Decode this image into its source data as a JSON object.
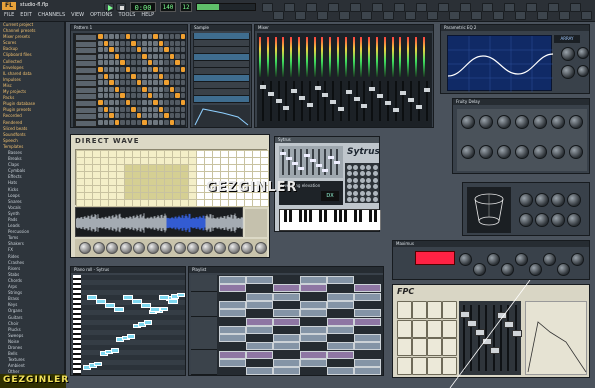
{
  "topbar": {
    "logo": "FL",
    "song_title": "studio-fl.flp",
    "menu": [
      "FILE",
      "EDIT",
      "CHANNELS",
      "VIEW",
      "OPTIONS",
      "TOOLS",
      "HELP"
    ],
    "time_display": "0:00",
    "tempo_display": "140",
    "pattern_display": "12"
  },
  "browser": {
    "items": [
      {
        "label": "Current project",
        "folder": true
      },
      {
        "label": "Channel presets",
        "folder": true
      },
      {
        "label": "Mixer presets",
        "folder": true
      },
      {
        "label": "Scores",
        "folder": true
      },
      {
        "label": "Backup",
        "folder": true
      },
      {
        "label": "Clipboard files",
        "folder": true
      },
      {
        "label": "Collected",
        "folder": true
      },
      {
        "label": "Envelopes",
        "folder": true
      },
      {
        "label": "IL shared data",
        "folder": true
      },
      {
        "label": "Impulses",
        "folder": true
      },
      {
        "label": "Misc",
        "folder": true
      },
      {
        "label": "My projects",
        "folder": true
      },
      {
        "label": "Packs",
        "folder": true
      },
      {
        "label": "Plugin database",
        "folder": true
      },
      {
        "label": "Plugin presets",
        "folder": true
      },
      {
        "label": "Recorded",
        "folder": true
      },
      {
        "label": "Rendered",
        "folder": true
      },
      {
        "label": "Sliced beats",
        "folder": true
      },
      {
        "label": "Soundfonts",
        "folder": true
      },
      {
        "label": "Speech",
        "folder": true
      },
      {
        "label": "Templates",
        "folder": true
      },
      {
        "label": "Basses",
        "folder": false
      },
      {
        "label": "Breaks",
        "folder": false
      },
      {
        "label": "Claps",
        "folder": false
      },
      {
        "label": "Cymbals",
        "folder": false
      },
      {
        "label": "Effects",
        "folder": false
      },
      {
        "label": "Hats",
        "folder": false
      },
      {
        "label": "Kicks",
        "folder": false
      },
      {
        "label": "Loops",
        "folder": false
      },
      {
        "label": "Snares",
        "folder": false
      },
      {
        "label": "Vocals",
        "folder": false
      },
      {
        "label": "Synth",
        "folder": false
      },
      {
        "label": "Pads",
        "folder": false
      },
      {
        "label": "Leads",
        "folder": false
      },
      {
        "label": "Percussion",
        "folder": false
      },
      {
        "label": "Toms",
        "folder": false
      },
      {
        "label": "Shakers",
        "folder": false
      },
      {
        "label": "FX",
        "folder": false
      },
      {
        "label": "Rides",
        "folder": false
      },
      {
        "label": "Crashes",
        "folder": false
      },
      {
        "label": "Risers",
        "folder": false
      },
      {
        "label": "Stabs",
        "folder": false
      },
      {
        "label": "Chords",
        "folder": false
      },
      {
        "label": "Arps",
        "folder": false
      },
      {
        "label": "Strings",
        "folder": false
      },
      {
        "label": "Brass",
        "folder": false
      },
      {
        "label": "Keys",
        "folder": false
      },
      {
        "label": "Organs",
        "folder": false
      },
      {
        "label": "Guitars",
        "folder": false
      },
      {
        "label": "Choir",
        "folder": false
      },
      {
        "label": "Plucks",
        "folder": false
      },
      {
        "label": "Sweeps",
        "folder": false
      },
      {
        "label": "Noise",
        "folder": false
      },
      {
        "label": "Drones",
        "folder": false
      },
      {
        "label": "Bells",
        "folder": false
      },
      {
        "label": "Textures",
        "folder": false
      },
      {
        "label": "Ambient",
        "folder": false
      },
      {
        "label": "Other",
        "folder": false
      }
    ]
  },
  "windows": {
    "step_sequencer": {
      "title": "Pattern 1"
    },
    "playlist_small": {
      "title": "Sample"
    },
    "mixer": {
      "title": "Mixer"
    },
    "eq": {
      "title": "Parametric EQ 2",
      "badge": "ARRAY"
    },
    "delay": {
      "title": "Fruity Delay"
    },
    "directwave": {
      "title": "DIRECTWAVE",
      "logo": "DIRECT WAVE"
    },
    "sytrus": {
      "title": "Sytrus",
      "logo": "Sytrus",
      "preset": "Sweeping elevation",
      "value": "DX"
    },
    "box3d": {
      "title": "Fruity Spectroman"
    },
    "compressor": {
      "title": "Maximus"
    },
    "piano_roll": {
      "title": "Piano roll - Sytrus"
    },
    "playlist": {
      "title": "Playlist"
    },
    "fpc": {
      "title": "FPC",
      "logo": "FPC"
    },
    "synth_panel": {
      "title": "Slicex"
    }
  },
  "watermarks": {
    "center": "GEZGINLER",
    "bottom": "GEZGINLER"
  },
  "colors": {
    "accent_green": "#7dff8f",
    "accent_orange": "#f0a030",
    "lcd_red": "#ff2244"
  }
}
